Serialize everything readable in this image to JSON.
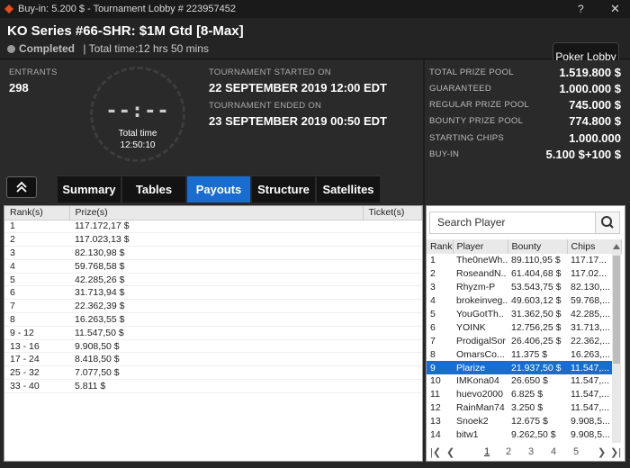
{
  "titlebar": {
    "title": "Buy-in: 5.200 $ - Tournament Lobby # 223957452",
    "help": "?",
    "close": "✕"
  },
  "header": {
    "name": "KO Series #66-SHR: $1M Gtd [8-Max]",
    "status": "Completed",
    "total_time_text": "| Total time:12 hrs  50 mins",
    "lobby_button": "Poker Lobby"
  },
  "info": {
    "entrants_label": "ENTRANTS",
    "entrants": "298",
    "clock_digits": "--:--",
    "total_time_label": "Total time",
    "total_time": "12:50:10",
    "started_label": "TOURNAMENT STARTED ON",
    "started": "22 SEPTEMBER 2019   12:00 EDT",
    "ended_label": "TOURNAMENT ENDED ON",
    "ended": "23 SEPTEMBER 2019   00:50 EDT"
  },
  "prizes": [
    {
      "label": "TOTAL PRIZE POOL",
      "value": "1.519.800 $"
    },
    {
      "label": "GUARANTEED",
      "value": "1.000.000 $"
    },
    {
      "label": "REGULAR PRIZE POOL",
      "value": "745.000 $"
    },
    {
      "label": "BOUNTY PRIZE POOL",
      "value": "774.800 $"
    },
    {
      "label": "STARTING CHIPS",
      "value": "1.000.000"
    },
    {
      "label": "BUY-IN",
      "value": "5.100 $+100 $"
    }
  ],
  "tabs": [
    "Summary",
    "Tables",
    "Payouts",
    "Structure",
    "Satellites"
  ],
  "active_tab": "Payouts",
  "payouts": {
    "headers": [
      "Rank(s)",
      "Prize(s)",
      "Ticket(s)"
    ],
    "rows": [
      [
        "1",
        "117.172,17 $"
      ],
      [
        "2",
        "117.023,13 $"
      ],
      [
        "3",
        "82.130,98 $"
      ],
      [
        "4",
        "59.768,58 $"
      ],
      [
        "5",
        "42.285,26 $"
      ],
      [
        "6",
        "31.713,94 $"
      ],
      [
        "7",
        "22.362,39 $"
      ],
      [
        "8",
        "16.263,55 $"
      ],
      [
        "9 - 12",
        "11.547,50 $"
      ],
      [
        "13 - 16",
        "9.908,50 $"
      ],
      [
        "17 - 24",
        "8.418,50 $"
      ],
      [
        "25 - 32",
        "7.077,50 $"
      ],
      [
        "33 - 40",
        "5.811 $"
      ]
    ]
  },
  "players": {
    "search_placeholder": "Search Player",
    "headers": [
      "Rank",
      "Player",
      "Bounty",
      "Chips"
    ],
    "rows": [
      [
        "1",
        "The0neWh..",
        "89.110,95 $",
        "117.17..."
      ],
      [
        "2",
        "RoseandN..",
        "61.404,68 $",
        "117.02..."
      ],
      [
        "3",
        "Rhyzm-P",
        "53.543,75 $",
        "82.130,..."
      ],
      [
        "4",
        "brokeinveg..",
        "49.603,12 $",
        "59.768,..."
      ],
      [
        "5",
        "YouGotTh..",
        "31.362,50 $",
        "42.285,..."
      ],
      [
        "6",
        "YOINK",
        "12.756,25 $",
        "31.713,..."
      ],
      [
        "7",
        "ProdigalSor",
        "26.406,25 $",
        "22.362,..."
      ],
      [
        "8",
        "OmarsCo...",
        "11.375 $",
        "16.263,..."
      ],
      [
        "9",
        "Plarize",
        "21.937,50 $",
        "11.547,..."
      ],
      [
        "10",
        "IMKona04",
        "26.650 $",
        "11.547,..."
      ],
      [
        "11",
        "huevo2000",
        "6.825 $",
        "11.547,..."
      ],
      [
        "12",
        "RainMan74",
        "3.250 $",
        "11.547,..."
      ],
      [
        "13",
        "Snoek2",
        "12.675 $",
        "9.908,5..."
      ],
      [
        "14",
        "bitw1",
        "9.262,50 $",
        "9.908,5..."
      ]
    ],
    "selected_rank": "9",
    "pages": [
      "1",
      "2",
      "3",
      "4",
      "5"
    ],
    "current_page": "1"
  },
  "colors": {
    "accent": "#1a6dd0",
    "background": "#262626"
  }
}
